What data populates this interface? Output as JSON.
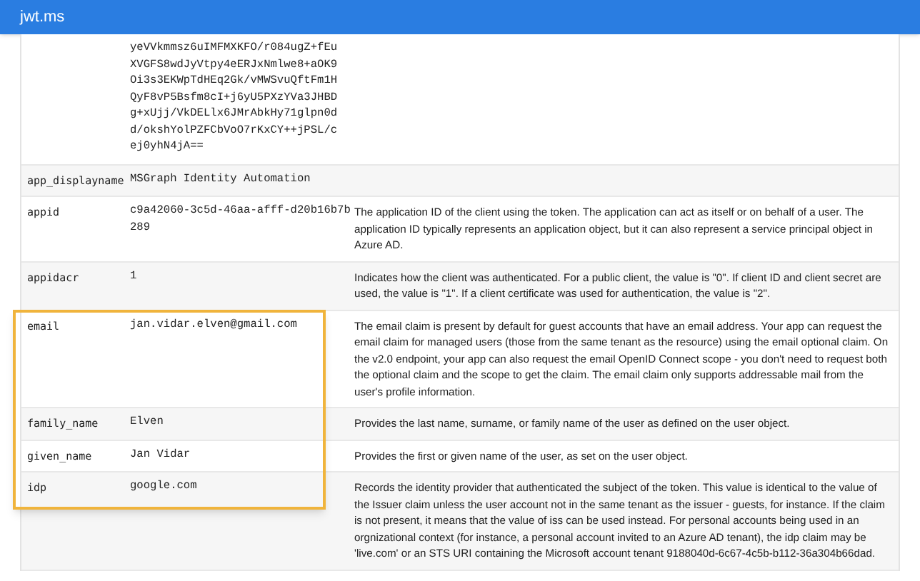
{
  "header": {
    "title": "jwt.ms"
  },
  "claims": [
    {
      "value_lines": [
        "yeVVkmmsz6uIMFMXKFO/r084ugZ+fEu",
        "XVGFS8wdJyVtpy4eERJxNmlwe8+aOK9",
        "Oi3s3EKWpTdHEq2Gk/vMWSvuQftFm1H",
        "QyF8vP5Bsfm8cI+j6yU5PXzYVa3JHBD",
        "g+xUjj/VkDELlx6JMrAbkHy71glpn0d",
        "d/okshYolPZFCbVoO7rKxCY++jPSL/c",
        "ej0yhN4jA=="
      ]
    },
    {
      "name": "app_displayname",
      "value": "MSGraph Identity Automation"
    },
    {
      "name": "appid",
      "value": "c9a42060-3c5d-46aa-afff-d20b16b7b289",
      "description": "The application ID of the client using the token. The application can act as itself or on behalf of a user. The application ID typically represents an application object, but it can also represent a service principal object in Azure AD."
    },
    {
      "name": "appidacr",
      "value": "1",
      "description": "Indicates how the client was authenticated. For a public client, the value is \"0\". If client ID and client secret are used, the value is \"1\". If a client certificate was used for authentication, the value is \"2\"."
    },
    {
      "name": "email",
      "value": "jan.vidar.elven@gmail.com",
      "description": "The email claim is present by default for guest accounts that have an email address. Your app can request the email claim for managed users (those from the same tenant as the resource) using the email optional claim. On the v2.0 endpoint, your app can also request the email OpenID Connect scope - you don't need to request both the optional claim and the scope to get the claim. The email claim only supports addressable mail from the user's profile information."
    },
    {
      "name": "family_name",
      "value": "Elven",
      "description": "Provides the last name, surname, or family name of the user as defined on the user object."
    },
    {
      "name": "given_name",
      "value": "Jan Vidar",
      "description": "Provides the first or given name of the user, as set on the user object."
    },
    {
      "name": "idp",
      "value": "google.com",
      "description": "Records the identity provider that authenticated the subject of the token. This value is identical to the value of the Issuer claim unless the user account not in the same tenant as the issuer - guests, for instance. If the claim is not present, it means that the value of iss can be used instead. For personal accounts being used in an orgnizational context (for instance, a personal account invited to an Azure AD tenant), the idp claim may be 'live.com' or an STS URI containing the Microsoft account tenant 9188040d-6c67-4c5b-b112-36a304b66dad."
    }
  ],
  "annotation": {
    "kind": "highlight-box"
  }
}
